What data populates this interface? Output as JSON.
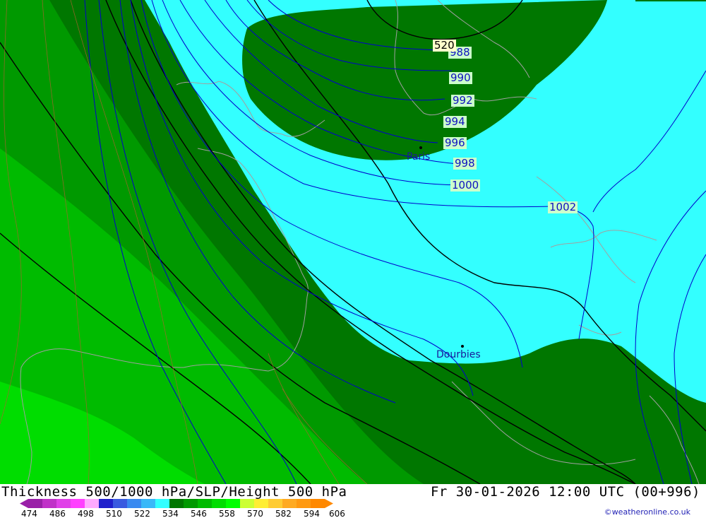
{
  "map": {
    "colors": {
      "cyan": "#33ffff",
      "dark_green": "#007700",
      "mid_green": "#009900",
      "bright_green": "#00bb00",
      "light_green": "#00dd00",
      "isobar": "#0000cc",
      "height": "#000000",
      "coast": "#a0a0a0"
    },
    "isobar_labels": [
      "988",
      "990",
      "992",
      "994",
      "996",
      "998",
      "1000",
      "1002"
    ],
    "height_labels": [
      "520"
    ],
    "cities": [
      {
        "name": "Paris"
      },
      {
        "name": "Dourbies"
      }
    ]
  },
  "footer": {
    "title": "Thickness 500/1000 hPa/SLP/Height 500 hPa",
    "datetime": "Fr 30-01-2026 12:00 UTC (00+996)",
    "credit": "©weatheronline.co.uk",
    "legend": {
      "ticks": [
        "474",
        "486",
        "498",
        "510",
        "522",
        "534",
        "546",
        "558",
        "570",
        "582",
        "594",
        "606"
      ],
      "colors": [
        "#9a20a8",
        "#c030c8",
        "#e040e8",
        "#ff40ff",
        "#ffaaff",
        "#2020cc",
        "#3a5ae0",
        "#3a8af0",
        "#3ab8f8",
        "#33ffff",
        "#007700",
        "#009900",
        "#00bb00",
        "#00dd00",
        "#00ff00",
        "#ccff33",
        "#ffee33",
        "#ffcc33",
        "#ffaa22",
        "#ff9911",
        "#ff8800"
      ]
    }
  }
}
